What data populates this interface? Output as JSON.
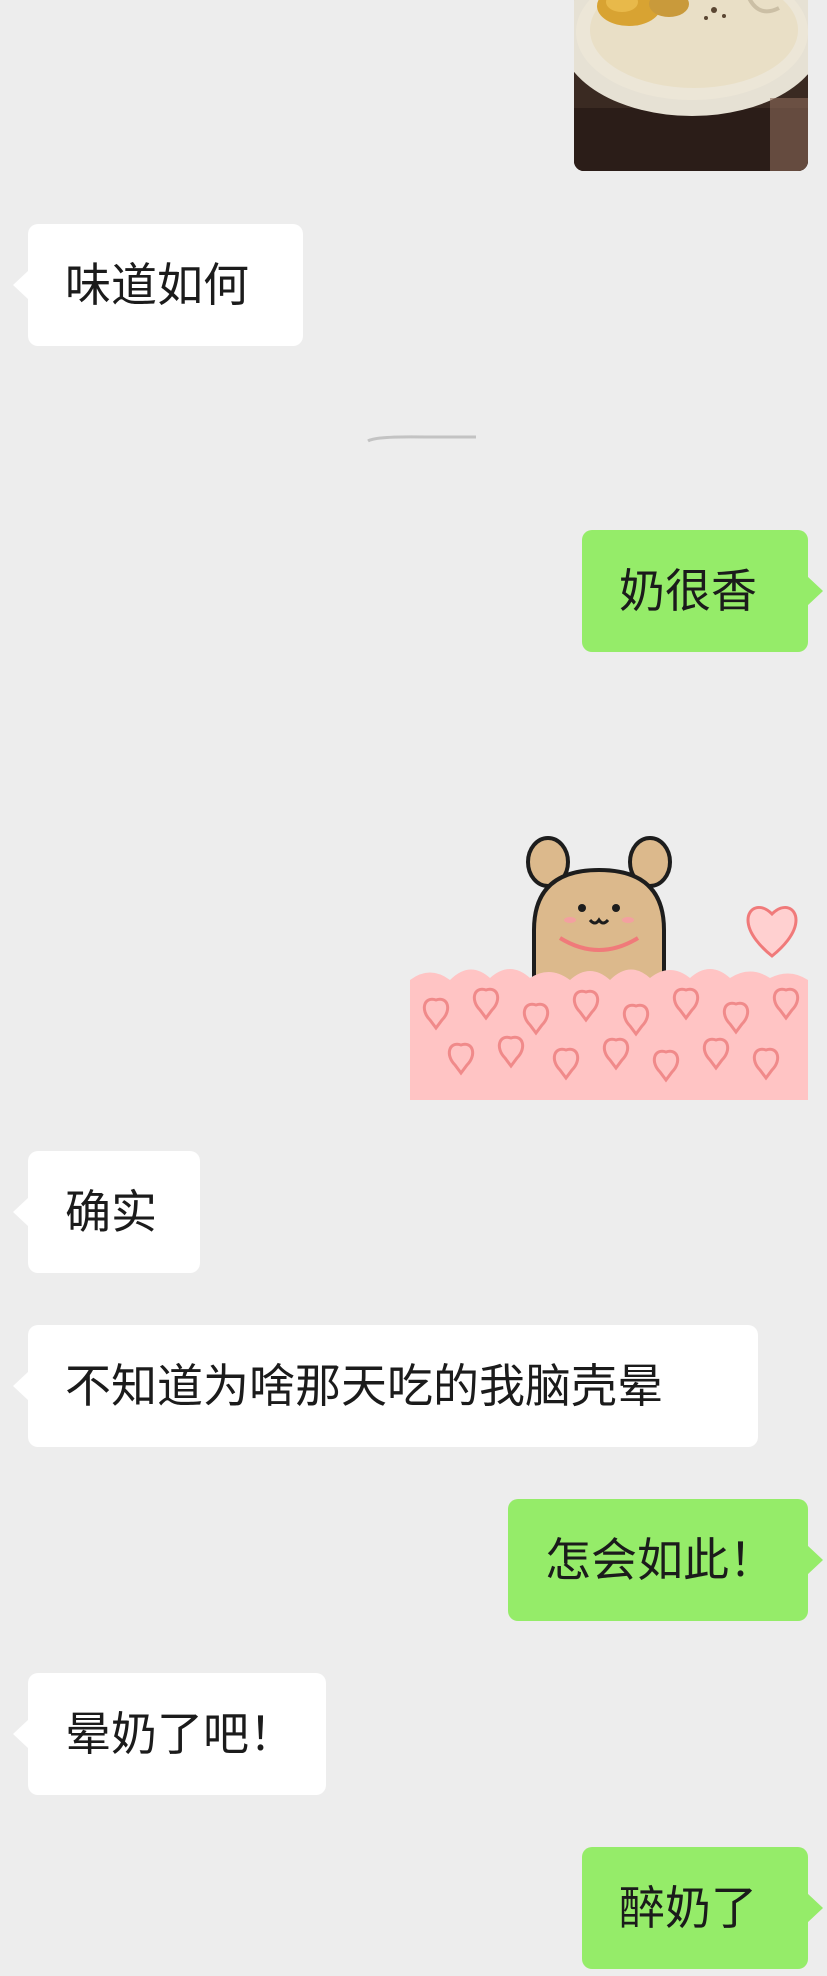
{
  "conversation": {
    "messages": [
      {
        "id": "m1",
        "sender": "other",
        "type": "image",
        "content": "photo-of-milk-dessert-bowl"
      },
      {
        "id": "m2",
        "sender": "other",
        "type": "text",
        "text": "味道如何"
      },
      {
        "id": "m3",
        "sender": "me",
        "type": "text",
        "text": "奶很香"
      },
      {
        "id": "m4",
        "sender": "me",
        "type": "sticker",
        "content": "bear-in-hearts-sticker"
      },
      {
        "id": "m5",
        "sender": "other",
        "type": "text",
        "text": "确实"
      },
      {
        "id": "m6",
        "sender": "other",
        "type": "text",
        "text": "不知道为啥那天吃的我脑壳晕"
      },
      {
        "id": "m7",
        "sender": "me",
        "type": "text",
        "text": "怎会如此！"
      },
      {
        "id": "m8",
        "sender": "other",
        "type": "text",
        "text": "晕奶了吧！"
      },
      {
        "id": "m9",
        "sender": "me",
        "type": "text",
        "text": "醉奶了"
      }
    ]
  },
  "colors": {
    "background": "#ededed",
    "incoming_bubble": "#ffffff",
    "outgoing_bubble": "#95ec69",
    "text": "#1b1b1b",
    "sticker_pink": "#ffc4c4",
    "sticker_heart_stroke": "#f07a7a",
    "bear_body": "#dcb98c"
  }
}
